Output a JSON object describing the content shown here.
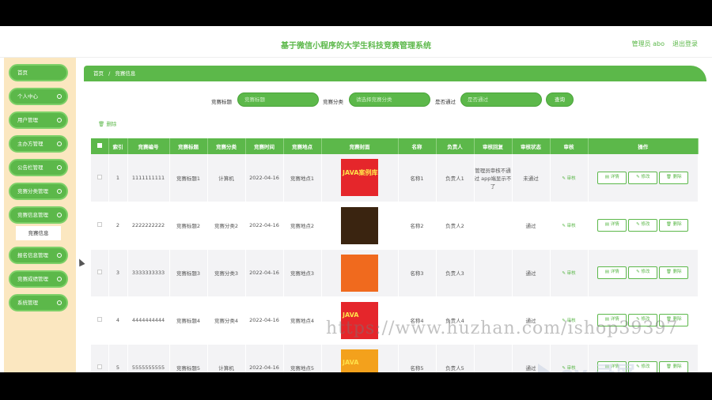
{
  "header": {
    "title": "基于微信小程序的大学生科技竞赛管理系统",
    "admin_label": "管理员 abo",
    "logout_label": "退出登录"
  },
  "sidebar": {
    "items": [
      {
        "label": "首页"
      },
      {
        "label": "个人中心"
      },
      {
        "label": "用户管理"
      },
      {
        "label": "主办方管理"
      },
      {
        "label": "公告栏管理"
      },
      {
        "label": "竞赛分类管理"
      },
      {
        "label": "竞赛信息管理"
      },
      {
        "label": "报名信息管理"
      },
      {
        "label": "竞赛成绩管理"
      },
      {
        "label": "系统管理"
      }
    ],
    "sub_item": "竞赛信息"
  },
  "breadcrumb": {
    "home": "首页",
    "sep": "/",
    "current": "竞赛信息"
  },
  "search": {
    "title_label": "竞赛标题",
    "title_placeholder": "竞赛标题",
    "category_label": "竞赛分类",
    "category_placeholder": "请选择竞赛分类",
    "pass_label": "是否通过",
    "pass_placeholder": "是否通过",
    "search_button": "查询"
  },
  "toolbar": {
    "delete_label": "删除"
  },
  "table": {
    "headers": [
      "索引",
      "竞赛编号",
      "竞赛标题",
      "竞赛分类",
      "竞赛时间",
      "竞赛地点",
      "竞赛封面",
      "名称",
      "负责人",
      "审核回复",
      "审核状态",
      "审核",
      "操作"
    ],
    "rows": [
      {
        "index": "1",
        "code": "1111111111",
        "title": "竞赛标题1",
        "category": "计算机",
        "time": "2022-04-16",
        "place": "竞赛地点1",
        "poster": "JAVA案例库",
        "name": "名称1",
        "owner": "负责人1",
        "reply": "管理员审核不通过 app端显示不了",
        "status": "未通过",
        "poster_color": "#e5262b"
      },
      {
        "index": "2",
        "code": "2222222222",
        "title": "竞赛标题2",
        "category": "竞赛分类2",
        "time": "2022-04-16",
        "place": "竞赛地点2",
        "poster": "",
        "name": "名称2",
        "owner": "负责人2",
        "reply": "",
        "status": "通过",
        "poster_color": "#3a2410"
      },
      {
        "index": "3",
        "code": "3333333333",
        "title": "竞赛标题3",
        "category": "竞赛分类3",
        "time": "2022-04-16",
        "place": "竞赛地点3",
        "poster": "",
        "name": "名称3",
        "owner": "负责人3",
        "reply": "",
        "status": "通过",
        "poster_color": "#f06a1e"
      },
      {
        "index": "4",
        "code": "4444444444",
        "title": "竞赛标题4",
        "category": "竞赛分类4",
        "time": "2022-04-16",
        "place": "竞赛地点4",
        "poster": "JAVA",
        "name": "名称4",
        "owner": "负责人4",
        "reply": "",
        "status": "通过",
        "poster_color": "#e5262b"
      },
      {
        "index": "5",
        "code": "5555555555",
        "title": "竞赛标题5",
        "category": "计算机",
        "time": "2022-04-16",
        "place": "竞赛地点5",
        "poster": "JAVA",
        "name": "名称5",
        "owner": "负责人5",
        "reply": "",
        "status": "通过",
        "poster_color": "#f3a11c"
      }
    ],
    "review_label": "审核",
    "detail_label": "详情",
    "edit_label": "修改",
    "delete_label": "删除"
  },
  "watermark": {
    "site": "https://www.huzhan.com/ishop39397",
    "brand": "ev 录屏"
  },
  "colors": {
    "accent": "#5cb84a",
    "sidebar_bg": "#fbe7c0"
  }
}
